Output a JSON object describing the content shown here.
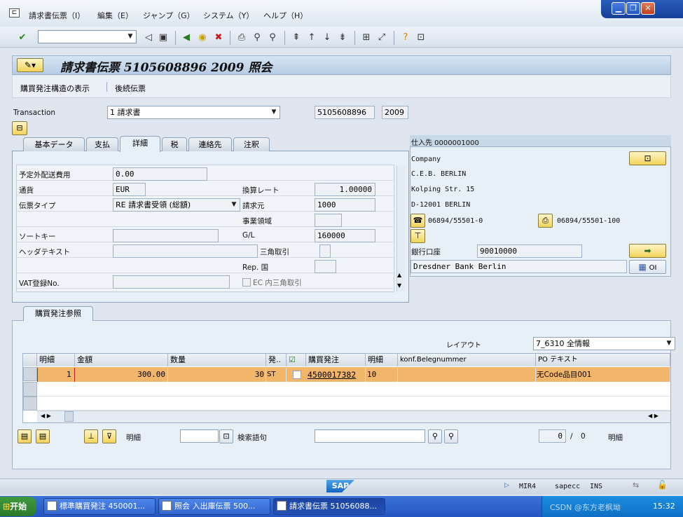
{
  "menu": {
    "items": [
      "請求書伝票（I）",
      "編集（E）",
      "ジャンプ（G）",
      "システム（Y）",
      "ヘルプ（H）"
    ]
  },
  "toolbar": {
    "command_value": ""
  },
  "title": "請求書伝票 5105608896 2009 照会",
  "appbar": {
    "btn1": "購買発注構造の表示",
    "btn2": "後続伝票"
  },
  "header": {
    "transaction_label": "Transaction",
    "transaction_value": "1 請求書",
    "doc_number": "5105608896",
    "year": "2009"
  },
  "tabs": [
    "基本データ",
    "支払",
    "詳細",
    "税",
    "連絡先",
    "注釈"
  ],
  "detail": {
    "unplanned_delivery_label": "予定外配送費用",
    "unplanned_delivery_value": "0.00",
    "currency_label": "通貨",
    "currency_value": "EUR",
    "exchange_rate_label": "換算レート",
    "exchange_rate_value": "1.00000",
    "doc_type_label": "伝票タイプ",
    "doc_type_value": "RE 請求書受領 (総額)",
    "invoicing_party_label": "請求元",
    "invoicing_party_value": "1000",
    "business_area_label": "事業領域",
    "business_area_value": "",
    "sort_key_label": "ソートキー",
    "sort_key_value": "",
    "gl_label": "G/L",
    "gl_value": "160000",
    "header_text_label": "ヘッダテキスト",
    "header_text_value": "",
    "triangulation_label": "三角取引",
    "rep_country_label": "Rep. 国",
    "rep_country_value": "",
    "vat_label": "VAT登録No.",
    "vat_value": "",
    "ec_triangulation_label": "EC 内三角取引"
  },
  "vendor": {
    "header": "仕入先 0000001000",
    "line1": "Company",
    "line2": "C.E.B. BERLIN",
    "line3": "Kolping Str. 15",
    "line4": "D-12001 BERLIN",
    "phone": "06894/55501-0",
    "fax": "06894/55501-100",
    "bank_account_label": "銀行口座",
    "bank_account_value": "90010000",
    "bank_name": "Dresdner Bank Berlin",
    "oi_label": "OI"
  },
  "po_section": {
    "tab_label": "購買発注参照",
    "layout_label": "レイアウト",
    "layout_value": "7_6310 全情報",
    "columns": [
      "明細",
      "金額",
      "数量",
      "発..",
      "",
      "購買発注",
      "明細",
      "konf.Belegnummer",
      "PO テキスト"
    ],
    "rows": [
      {
        "item": "1",
        "amount": "300.00",
        "qty": "30",
        "unit": "ST",
        "po": "4500017382",
        "po_item": "10",
        "konf": "",
        "po_text": "无Code品目001"
      }
    ],
    "footer_item_label": "明細",
    "search_label": "検索語句",
    "count_value": "0",
    "count_sep": "/",
    "count_total": "0",
    "count_label": "明細"
  },
  "status": {
    "system": "MIR4",
    "client": "sapecc",
    "mode": "INS"
  },
  "taskbar": {
    "start": "开始",
    "tasks": [
      "標準購買発注 450001...",
      "照会 入出庫伝票 500...",
      "請求書伝票 51056088..."
    ],
    "clock": "15:32",
    "watermark": "CSDN @东方老枫坳"
  }
}
